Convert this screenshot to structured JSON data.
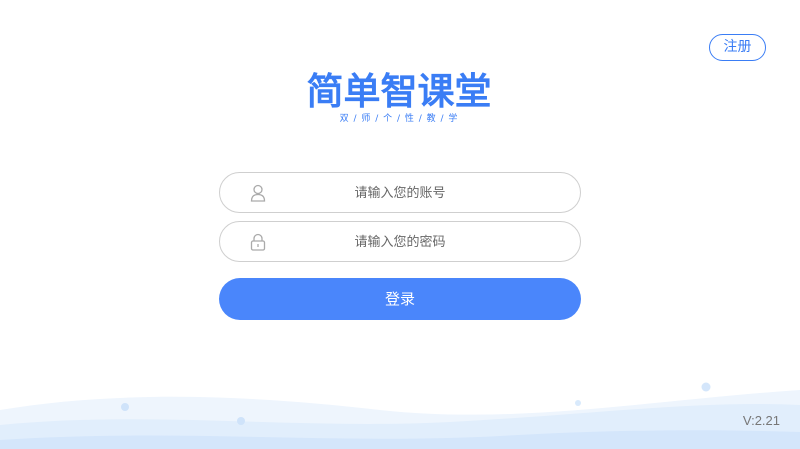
{
  "header": {
    "register_label": "注册"
  },
  "logo": {
    "title": "简单智课堂",
    "subtitle": "双 / 师 / 个 / 性 / 教 / 学"
  },
  "login_form": {
    "account_placeholder": "请输入您的账号",
    "password_placeholder": "请输入您的密码",
    "submit_label": "登录",
    "account_icon": "user-icon",
    "password_icon": "lock-icon"
  },
  "footer": {
    "version": "V:2.21"
  },
  "colors": {
    "accent": "#3a7df5",
    "button": "#4a86fb",
    "wave_light": "#eaf3fd",
    "wave_mid": "#d6e8fb"
  }
}
